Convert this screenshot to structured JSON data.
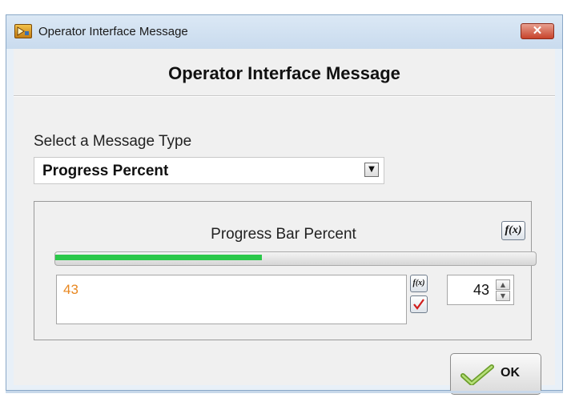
{
  "window": {
    "title": "Operator Interface Message",
    "close_glyph": "✕"
  },
  "dialog": {
    "heading": "Operator Interface Message"
  },
  "message_type": {
    "label": "Select a Message Type",
    "selected": "Progress Percent"
  },
  "progress": {
    "label": "Progress Bar Percent",
    "percent": 43,
    "expression": "43",
    "numeric_value": "43",
    "fill_color": "#2bc84a",
    "expression_color": "#e88720"
  },
  "buttons": {
    "fx_label": "f(x)",
    "ok_label": "OK"
  },
  "icons": {
    "app": "labview-app-icon",
    "close": "close-icon",
    "dropdown": "chevron-down-icon",
    "fx": "function-icon",
    "check": "checkmark-icon",
    "spin_up": "arrow-up-icon",
    "spin_down": "arrow-down-icon"
  }
}
